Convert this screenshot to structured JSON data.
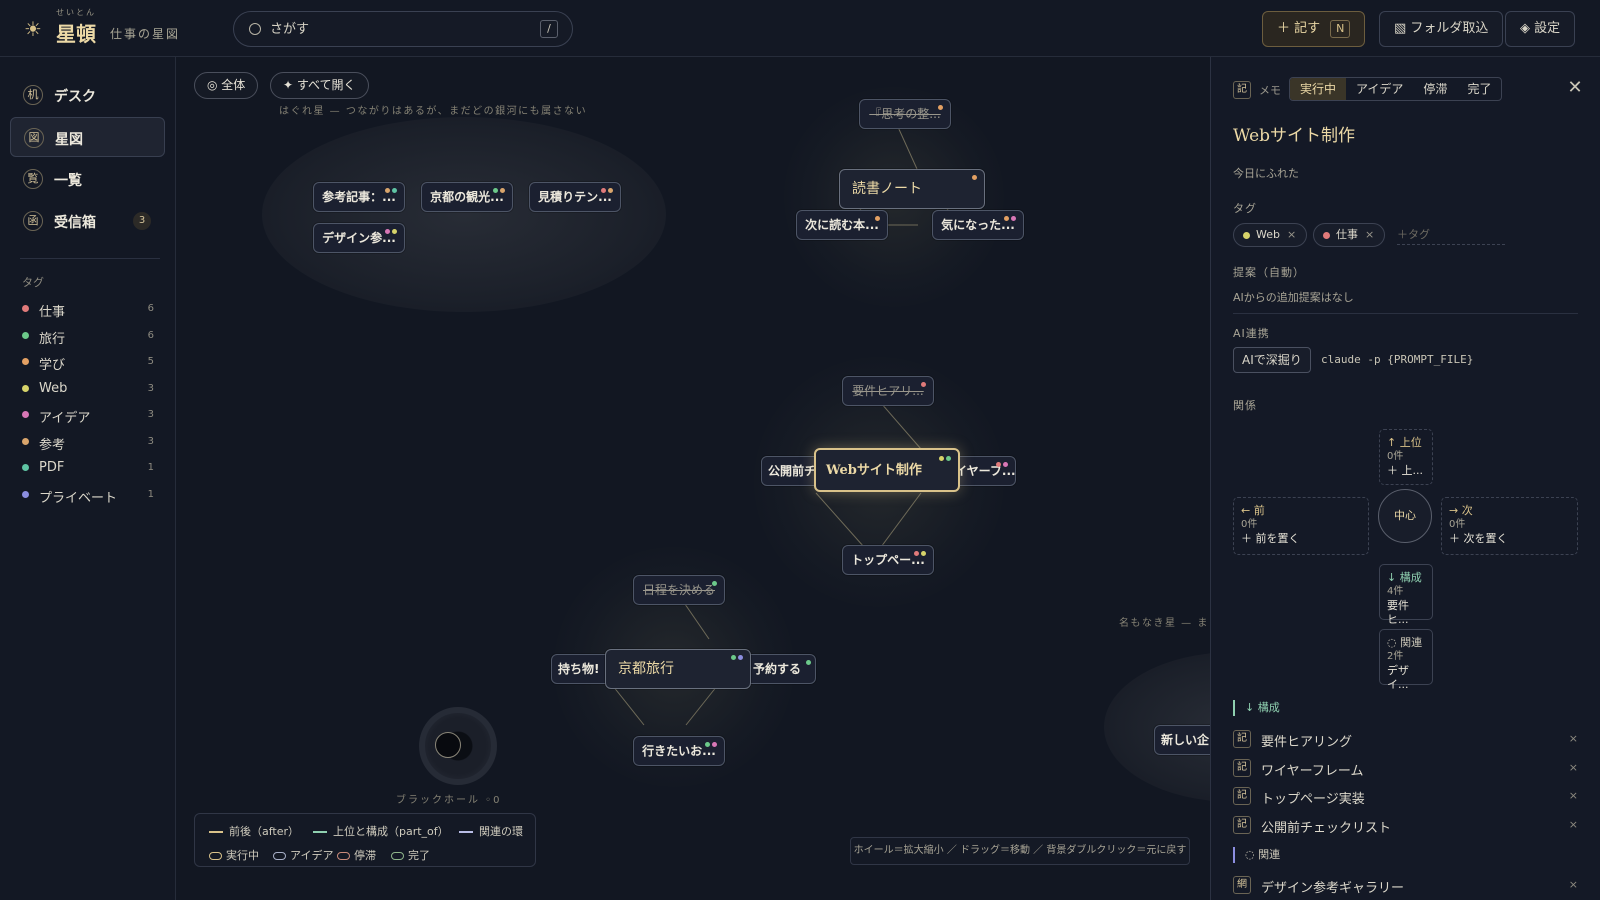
{
  "header": {
    "logo_ruby": "せいとん",
    "logo_title": "星頓",
    "logo_subtitle": "仕事の星図",
    "search_placeholder": "さがす",
    "search_shortcut": "/",
    "record_label": "＋ 記す",
    "record_shortcut": "N",
    "import_label": "▧ フォルダ取込",
    "settings_label": "◈ 設定"
  },
  "sidebar": {
    "nav": [
      {
        "glyph": "机",
        "label": "デスク"
      },
      {
        "glyph": "図",
        "label": "星図"
      },
      {
        "glyph": "覧",
        "label": "一覧"
      },
      {
        "glyph": "函",
        "label": "受信箱",
        "badge": "3"
      }
    ],
    "tags_header": "タグ",
    "tags": [
      {
        "name": "仕事",
        "count": "6",
        "color": "#e07a7a"
      },
      {
        "name": "旅行",
        "count": "6",
        "color": "#6cc98a"
      },
      {
        "name": "学び",
        "count": "5",
        "color": "#e3a063"
      },
      {
        "name": "Web",
        "count": "3",
        "color": "#d6d36a"
      },
      {
        "name": "アイデア",
        "count": "3",
        "color": "#d877b6"
      },
      {
        "name": "参考",
        "count": "3",
        "color": "#d9a56c"
      },
      {
        "name": "PDF",
        "count": "1",
        "color": "#5fc4a4"
      },
      {
        "name": "プライベート",
        "count": "1",
        "color": "#8c8ee0"
      }
    ]
  },
  "canvas": {
    "btn_all": "◎ 全体",
    "btn_expand": "✦ すべて開く",
    "stray_label": "はぐれ星 — つながりはあるが、まだどの銀河にも属さない",
    "nameless_label": "名もなき星 — ま",
    "nodes": {
      "ref_article": "参考記事：...",
      "kyoto_sight": "京都の観光...",
      "estimate": "見積りテン...",
      "design_ref": "デザイン参...",
      "thinking": "『思考の整...",
      "reading_note": "読書ノート",
      "next_read": "次に読む本...",
      "curious": "気になった...",
      "requirements": "要件ヒアリ...",
      "prelaunch": "公開前チ",
      "website": "Webサイト制作",
      "wireframe": "ワイヤーフ...",
      "toppage": "トップペー...",
      "schedule": "日程を決める",
      "belongings": "持ち物!",
      "kyoto_trip": "京都旅行",
      "reserve": "予約する",
      "wanted_place": "行きたいお...",
      "new_plan": "新しい企"
    },
    "blackhole_label": "ブラックホール ◦0",
    "legend": {
      "after": "前後（after）",
      "part_of": "上位と構成（part_of）",
      "related": "関連の環",
      "running": "実行中",
      "idea": "アイデア",
      "stalled": "停滞",
      "done": "完了"
    },
    "hint": "ホイール＝拡大縮小 ／ ドラッグ＝移動 ／ 背景ダブルクリック＝元に戻す"
  },
  "panel": {
    "kind_glyph": "記",
    "kind_label": "メモ",
    "status_tabs": [
      "実行中",
      "アイデア",
      "停滞",
      "完了"
    ],
    "status_active": 0,
    "close": "✕",
    "title": "Webサイト制作",
    "meta": "今日にふれた",
    "tags_label": "タグ",
    "tags": [
      {
        "name": "Web",
        "color": "#d6d36a"
      },
      {
        "name": "仕事",
        "color": "#e07a7a"
      }
    ],
    "tag_remove": "×",
    "tag_placeholder": "＋タグ",
    "suggest_label": "提案（自動）",
    "suggest_text": "AIからの追加提案はなし",
    "ai_label": "AI連携",
    "ai_button": "AIで深掘り",
    "ai_command": "claude -p {PROMPT_FILE}",
    "relations_label": "関係",
    "relations": {
      "parent": {
        "title": "↑ 上位",
        "count": "0件",
        "value": "＋ 上..."
      },
      "prev": {
        "title": "← 前",
        "count": "0件",
        "value": "＋ 前を置く"
      },
      "center": "中心",
      "next": {
        "title": "→ 次",
        "count": "0件",
        "value": "＋ 次を置く"
      },
      "parts": {
        "title": "↓ 構成",
        "count": "4件",
        "value": "要件ヒ..."
      },
      "related": {
        "title": "◌ 関連",
        "count": "2件",
        "value": "デザイ..."
      }
    },
    "parts_header": "↓ 構成",
    "parts_items": [
      {
        "glyph": "記",
        "label": "要件ヒアリング"
      },
      {
        "glyph": "記",
        "label": "ワイヤーフレーム"
      },
      {
        "glyph": "記",
        "label": "トップページ実装"
      },
      {
        "glyph": "記",
        "label": "公開前チェックリスト"
      }
    ],
    "related_header": "◌ 関連",
    "related_items": [
      {
        "glyph": "網",
        "label": "デザイン参考ギャラリー"
      }
    ],
    "item_remove": "×"
  }
}
